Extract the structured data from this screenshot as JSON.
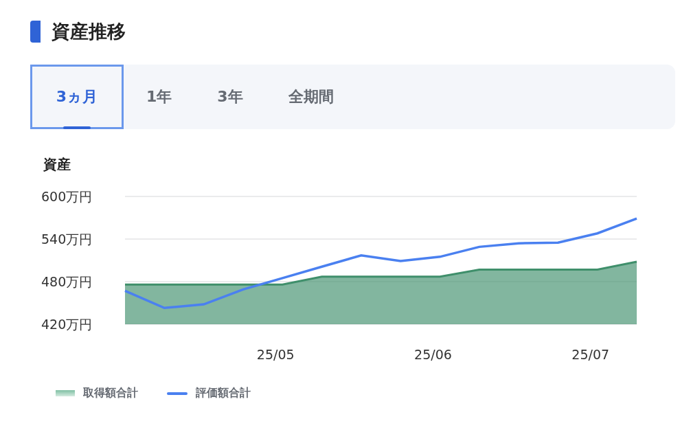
{
  "section": {
    "title": "資産推移"
  },
  "tabs": [
    {
      "label": "3ヵ月",
      "selected": true
    },
    {
      "label": "1年",
      "selected": false
    },
    {
      "label": "3年",
      "selected": false
    },
    {
      "label": "全期間",
      "selected": false
    }
  ],
  "chart": {
    "chart_data": {
      "type": "line",
      "ylabel": "資産",
      "categories": [
        null,
        null,
        null,
        null,
        "25/05",
        null,
        null,
        null,
        "25/06",
        null,
        null,
        null,
        "25/07",
        null
      ],
      "ylim": [
        420,
        600
      ],
      "yticks": [
        {
          "value": 420,
          "label": "420万円"
        },
        {
          "value": 480,
          "label": "480万円"
        },
        {
          "value": 540,
          "label": "540万円"
        },
        {
          "value": 600,
          "label": "600万円"
        }
      ],
      "series": [
        {
          "name": "取得額合計",
          "type": "area",
          "color": "#3f8f6b",
          "values": [
            476,
            476,
            476,
            476,
            476,
            487,
            487,
            487,
            487,
            497,
            497,
            497,
            497,
            508
          ]
        },
        {
          "name": "評価額合計",
          "type": "line",
          "color": "#4a80f0",
          "values": [
            467,
            443,
            448,
            469,
            485,
            501,
            517,
            509,
            515,
            529,
            534,
            535,
            548,
            569
          ]
        }
      ]
    }
  }
}
